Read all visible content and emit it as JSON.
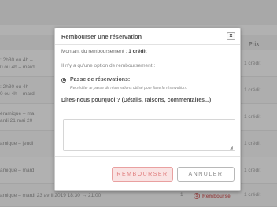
{
  "background": {
    "table": {
      "header_price": "Prix",
      "rows": [
        {
          "line1": ": 2h30 ou 4h –",
          "line2": "0 ou 4h – mard",
          "price": "1 crédit"
        },
        {
          "line1": ": 2h30 ou 4h –",
          "line2": "0 ou 4h – mard",
          "price": "1 crédit"
        },
        {
          "line1": "éramique – ma",
          "line2": "ardi 21 mai 20",
          "price": "1 crédit"
        },
        {
          "line1": "amique – jeudi",
          "line2": "",
          "price": "1 crédit"
        },
        {
          "line1": "amique – mard",
          "line2": "",
          "price": "1 crédit"
        },
        {
          "line1": "amique – mardi 23 avril 2019 18:30 → 21:00",
          "line2": "",
          "price": "1 crédit"
        }
      ],
      "last_row_qty": "1",
      "last_row_status": "Remboursé"
    }
  },
  "modal": {
    "title": "Rembourser une réservation",
    "close_label": "x",
    "amount_prefix": "Montant du remboursement : ",
    "amount_value": "1 crédit",
    "option_info": "Il n'y a qu'une option de remboursement :",
    "option_label": "Passe de réservations:",
    "option_desc": "Recréditer le passe de réservations utilisé pour faire la réservation.",
    "reason_label": "Dites-nous pourquoi ? (Détails, raisons, commentaires...)",
    "reason_value": "",
    "refund_button": "REMBOURSER",
    "cancel_button": "ANNULER"
  }
}
